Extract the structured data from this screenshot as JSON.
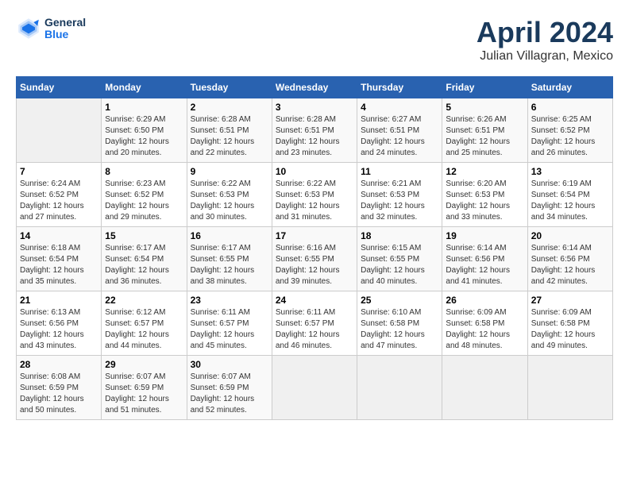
{
  "header": {
    "logo_line1": "General",
    "logo_line2": "Blue",
    "title": "April 2024",
    "subtitle": "Julian Villagran, Mexico"
  },
  "calendar": {
    "days_of_week": [
      "Sunday",
      "Monday",
      "Tuesday",
      "Wednesday",
      "Thursday",
      "Friday",
      "Saturday"
    ],
    "weeks": [
      [
        {
          "day": "",
          "info": ""
        },
        {
          "day": "1",
          "info": "Sunrise: 6:29 AM\nSunset: 6:50 PM\nDaylight: 12 hours\nand 20 minutes."
        },
        {
          "day": "2",
          "info": "Sunrise: 6:28 AM\nSunset: 6:51 PM\nDaylight: 12 hours\nand 22 minutes."
        },
        {
          "day": "3",
          "info": "Sunrise: 6:28 AM\nSunset: 6:51 PM\nDaylight: 12 hours\nand 23 minutes."
        },
        {
          "day": "4",
          "info": "Sunrise: 6:27 AM\nSunset: 6:51 PM\nDaylight: 12 hours\nand 24 minutes."
        },
        {
          "day": "5",
          "info": "Sunrise: 6:26 AM\nSunset: 6:51 PM\nDaylight: 12 hours\nand 25 minutes."
        },
        {
          "day": "6",
          "info": "Sunrise: 6:25 AM\nSunset: 6:52 PM\nDaylight: 12 hours\nand 26 minutes."
        }
      ],
      [
        {
          "day": "7",
          "info": "Sunrise: 6:24 AM\nSunset: 6:52 PM\nDaylight: 12 hours\nand 27 minutes."
        },
        {
          "day": "8",
          "info": "Sunrise: 6:23 AM\nSunset: 6:52 PM\nDaylight: 12 hours\nand 29 minutes."
        },
        {
          "day": "9",
          "info": "Sunrise: 6:22 AM\nSunset: 6:53 PM\nDaylight: 12 hours\nand 30 minutes."
        },
        {
          "day": "10",
          "info": "Sunrise: 6:22 AM\nSunset: 6:53 PM\nDaylight: 12 hours\nand 31 minutes."
        },
        {
          "day": "11",
          "info": "Sunrise: 6:21 AM\nSunset: 6:53 PM\nDaylight: 12 hours\nand 32 minutes."
        },
        {
          "day": "12",
          "info": "Sunrise: 6:20 AM\nSunset: 6:53 PM\nDaylight: 12 hours\nand 33 minutes."
        },
        {
          "day": "13",
          "info": "Sunrise: 6:19 AM\nSunset: 6:54 PM\nDaylight: 12 hours\nand 34 minutes."
        }
      ],
      [
        {
          "day": "14",
          "info": "Sunrise: 6:18 AM\nSunset: 6:54 PM\nDaylight: 12 hours\nand 35 minutes."
        },
        {
          "day": "15",
          "info": "Sunrise: 6:17 AM\nSunset: 6:54 PM\nDaylight: 12 hours\nand 36 minutes."
        },
        {
          "day": "16",
          "info": "Sunrise: 6:17 AM\nSunset: 6:55 PM\nDaylight: 12 hours\nand 38 minutes."
        },
        {
          "day": "17",
          "info": "Sunrise: 6:16 AM\nSunset: 6:55 PM\nDaylight: 12 hours\nand 39 minutes."
        },
        {
          "day": "18",
          "info": "Sunrise: 6:15 AM\nSunset: 6:55 PM\nDaylight: 12 hours\nand 40 minutes."
        },
        {
          "day": "19",
          "info": "Sunrise: 6:14 AM\nSunset: 6:56 PM\nDaylight: 12 hours\nand 41 minutes."
        },
        {
          "day": "20",
          "info": "Sunrise: 6:14 AM\nSunset: 6:56 PM\nDaylight: 12 hours\nand 42 minutes."
        }
      ],
      [
        {
          "day": "21",
          "info": "Sunrise: 6:13 AM\nSunset: 6:56 PM\nDaylight: 12 hours\nand 43 minutes."
        },
        {
          "day": "22",
          "info": "Sunrise: 6:12 AM\nSunset: 6:57 PM\nDaylight: 12 hours\nand 44 minutes."
        },
        {
          "day": "23",
          "info": "Sunrise: 6:11 AM\nSunset: 6:57 PM\nDaylight: 12 hours\nand 45 minutes."
        },
        {
          "day": "24",
          "info": "Sunrise: 6:11 AM\nSunset: 6:57 PM\nDaylight: 12 hours\nand 46 minutes."
        },
        {
          "day": "25",
          "info": "Sunrise: 6:10 AM\nSunset: 6:58 PM\nDaylight: 12 hours\nand 47 minutes."
        },
        {
          "day": "26",
          "info": "Sunrise: 6:09 AM\nSunset: 6:58 PM\nDaylight: 12 hours\nand 48 minutes."
        },
        {
          "day": "27",
          "info": "Sunrise: 6:09 AM\nSunset: 6:58 PM\nDaylight: 12 hours\nand 49 minutes."
        }
      ],
      [
        {
          "day": "28",
          "info": "Sunrise: 6:08 AM\nSunset: 6:59 PM\nDaylight: 12 hours\nand 50 minutes."
        },
        {
          "day": "29",
          "info": "Sunrise: 6:07 AM\nSunset: 6:59 PM\nDaylight: 12 hours\nand 51 minutes."
        },
        {
          "day": "30",
          "info": "Sunrise: 6:07 AM\nSunset: 6:59 PM\nDaylight: 12 hours\nand 52 minutes."
        },
        {
          "day": "",
          "info": ""
        },
        {
          "day": "",
          "info": ""
        },
        {
          "day": "",
          "info": ""
        },
        {
          "day": "",
          "info": ""
        }
      ]
    ]
  }
}
